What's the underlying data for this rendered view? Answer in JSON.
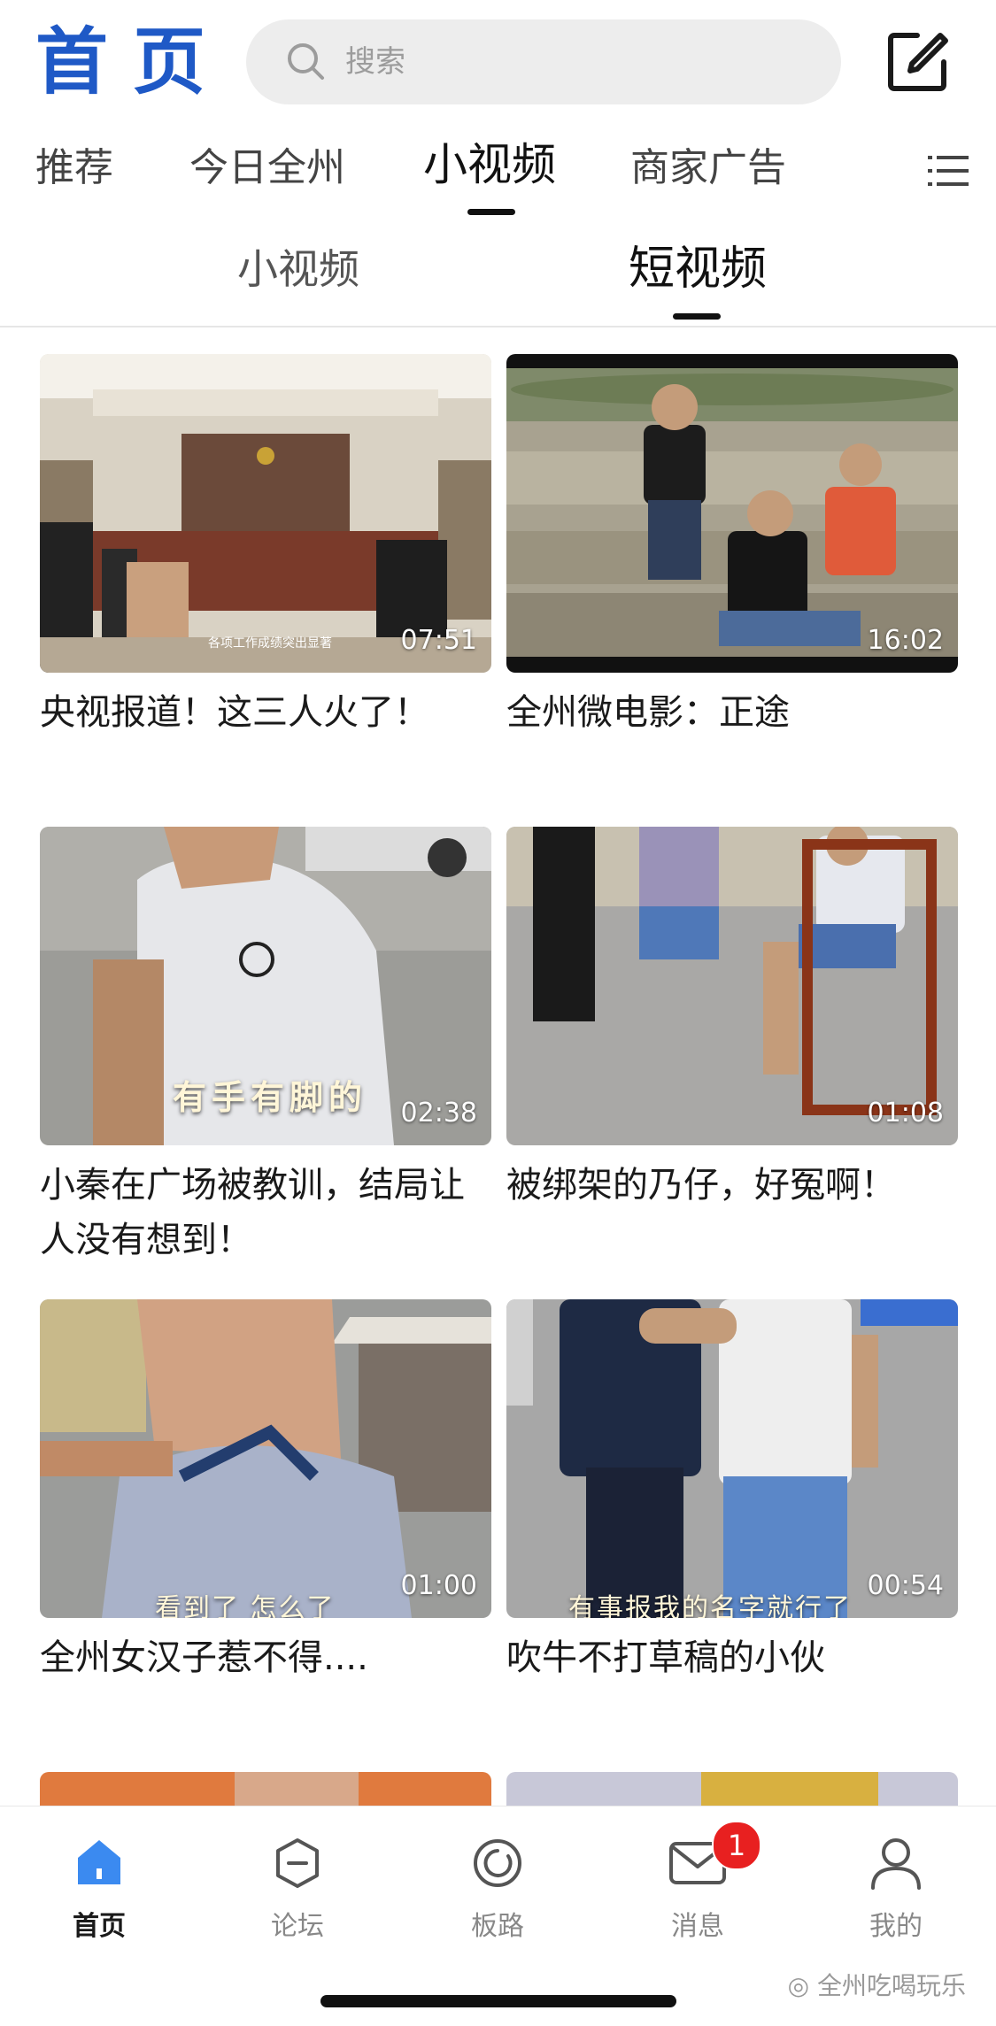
{
  "header": {
    "title": "首页",
    "search_placeholder": "搜索"
  },
  "tabs": [
    {
      "label": "推荐"
    },
    {
      "label": "今日全州"
    },
    {
      "label": "小视频",
      "active": true
    },
    {
      "label": "商家广告"
    }
  ],
  "subtabs": [
    {
      "label": "小视频"
    },
    {
      "label": "短视频",
      "active": true
    }
  ],
  "videos": [
    {
      "title": "央视报道！这三人火了！",
      "duration": "07:51",
      "overlay_text": "各项工作成绩突出显著"
    },
    {
      "title": "全州微电影：正途",
      "duration": "16:02"
    },
    {
      "title": "小秦在广场被教训，结局让人没有想到！",
      "duration": "02:38",
      "overlay_text": "有手有脚的"
    },
    {
      "title": "被绑架的乃仔，好冤啊！",
      "duration": "01:08"
    },
    {
      "title": "全州女汉子惹不得....",
      "duration": "01:00",
      "overlay_text": "看到了 怎么了"
    },
    {
      "title": "吹牛不打草稿的小伙",
      "duration": "00:54",
      "overlay_text": "有事报我的名字就行了"
    }
  ],
  "bottom_nav": [
    {
      "label": "首页",
      "icon": "home-icon",
      "active": true
    },
    {
      "label": "论坛",
      "icon": "forum-icon"
    },
    {
      "label": "板路",
      "icon": "chat-bubble-icon"
    },
    {
      "label": "消息",
      "icon": "mail-icon",
      "badge": "1"
    },
    {
      "label": "我的",
      "icon": "user-icon"
    }
  ],
  "watermark": "全州吃喝玩乐",
  "colors": {
    "brand": "#1f59c6",
    "badge": "#e82020"
  }
}
